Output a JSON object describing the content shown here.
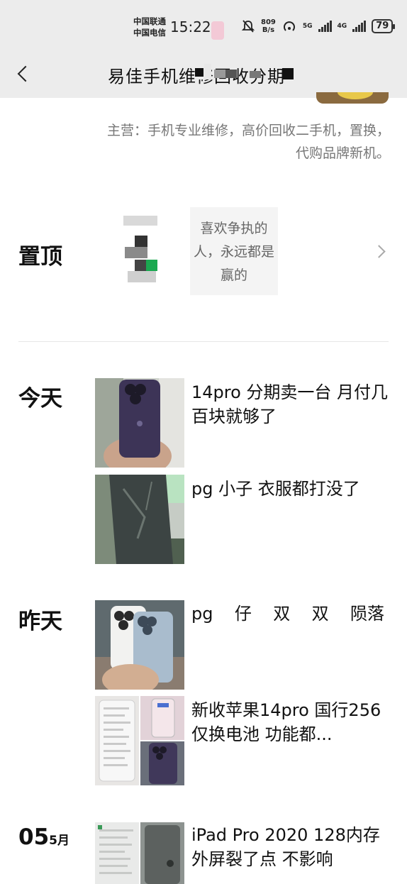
{
  "status_bar": {
    "carrier_1": "中国联通",
    "carrier_2": "中国电信",
    "time": "15:22",
    "net_speed_value": "809",
    "net_speed_unit": "B/s",
    "net_5g": "5G",
    "net_4g": "4G",
    "battery": "79"
  },
  "header": {
    "title": "易佳手机维修回收分期"
  },
  "profile": {
    "business": "主营：手机专业维修，高价回收二手机，置换，代购品牌新机。"
  },
  "pinned": {
    "label": "置顶",
    "card_text": "喜欢争执的人，永远都是赢的"
  },
  "posts": {
    "today": {
      "label": "今天",
      "items": [
        {
          "text": "14pro  分期卖一台  月付几百块就够了"
        },
        {
          "text": "pg  小子  衣服都打没了"
        }
      ]
    },
    "yesterday": {
      "label": "昨天",
      "items": [
        {
          "words": [
            "pg",
            "仔",
            "双",
            "双",
            "陨落"
          ]
        },
        {
          "text": "新收苹果14pro 国行256\n仅换电池 功能都..."
        }
      ]
    },
    "may5": {
      "day": "05",
      "month": "5月",
      "items": [
        {
          "text": "iPad Pro 2020  128内存\n外屏裂了点  不影响"
        }
      ]
    }
  },
  "colors": {
    "header_bg": "#ececec",
    "text_primary": "#111111",
    "text_secondary": "#777777",
    "card_bg": "#f4f4f4"
  }
}
